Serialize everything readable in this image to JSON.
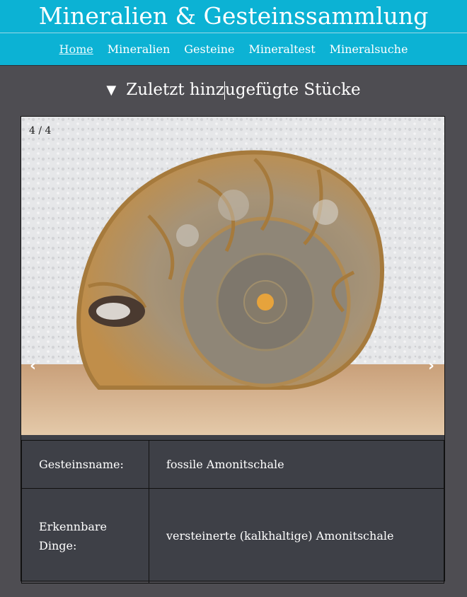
{
  "site": {
    "title": "Mineralien & Gesteinssammlung"
  },
  "nav": {
    "items": [
      {
        "label": "Home"
      },
      {
        "label": "Mineralien"
      },
      {
        "label": "Gesteine"
      },
      {
        "label": "Mineraltest"
      },
      {
        "label": "Mineralsuche"
      }
    ]
  },
  "section": {
    "title_a": "Zuletzt hinz",
    "title_b": "ugefügte Stücke"
  },
  "slideshow": {
    "counter": "4 / 4",
    "prev": "‹",
    "next": "›"
  },
  "details": {
    "rows": [
      {
        "label": "Gesteinsname:",
        "value": "fossile Amonitschale"
      },
      {
        "label": "Erkennbare Dinge:",
        "value": "versteinerte (kalkhaltige) Amonitschale"
      }
    ]
  }
}
